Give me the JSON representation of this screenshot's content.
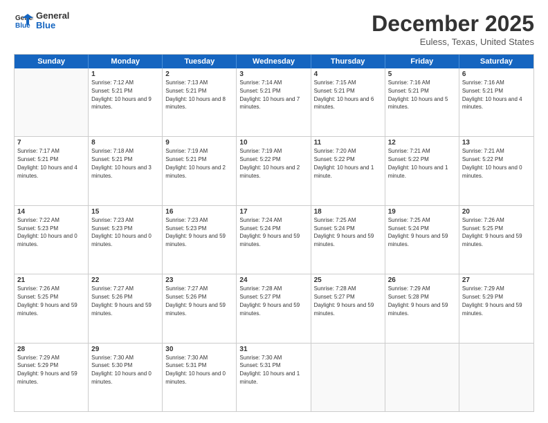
{
  "logo": {
    "line1": "General",
    "line2": "Blue"
  },
  "title": "December 2025",
  "subtitle": "Euless, Texas, United States",
  "days_header": [
    "Sunday",
    "Monday",
    "Tuesday",
    "Wednesday",
    "Thursday",
    "Friday",
    "Saturday"
  ],
  "weeks": [
    [
      {
        "day": "",
        "empty": true
      },
      {
        "day": "1",
        "sunrise": "7:12 AM",
        "sunset": "5:21 PM",
        "daylight": "10 hours and 9 minutes."
      },
      {
        "day": "2",
        "sunrise": "7:13 AM",
        "sunset": "5:21 PM",
        "daylight": "10 hours and 8 minutes."
      },
      {
        "day": "3",
        "sunrise": "7:14 AM",
        "sunset": "5:21 PM",
        "daylight": "10 hours and 7 minutes."
      },
      {
        "day": "4",
        "sunrise": "7:15 AM",
        "sunset": "5:21 PM",
        "daylight": "10 hours and 6 minutes."
      },
      {
        "day": "5",
        "sunrise": "7:16 AM",
        "sunset": "5:21 PM",
        "daylight": "10 hours and 5 minutes."
      },
      {
        "day": "6",
        "sunrise": "7:16 AM",
        "sunset": "5:21 PM",
        "daylight": "10 hours and 4 minutes."
      }
    ],
    [
      {
        "day": "7",
        "sunrise": "7:17 AM",
        "sunset": "5:21 PM",
        "daylight": "10 hours and 4 minutes."
      },
      {
        "day": "8",
        "sunrise": "7:18 AM",
        "sunset": "5:21 PM",
        "daylight": "10 hours and 3 minutes."
      },
      {
        "day": "9",
        "sunrise": "7:19 AM",
        "sunset": "5:21 PM",
        "daylight": "10 hours and 2 minutes."
      },
      {
        "day": "10",
        "sunrise": "7:19 AM",
        "sunset": "5:22 PM",
        "daylight": "10 hours and 2 minutes."
      },
      {
        "day": "11",
        "sunrise": "7:20 AM",
        "sunset": "5:22 PM",
        "daylight": "10 hours and 1 minute."
      },
      {
        "day": "12",
        "sunrise": "7:21 AM",
        "sunset": "5:22 PM",
        "daylight": "10 hours and 1 minute."
      },
      {
        "day": "13",
        "sunrise": "7:21 AM",
        "sunset": "5:22 PM",
        "daylight": "10 hours and 0 minutes."
      }
    ],
    [
      {
        "day": "14",
        "sunrise": "7:22 AM",
        "sunset": "5:23 PM",
        "daylight": "10 hours and 0 minutes."
      },
      {
        "day": "15",
        "sunrise": "7:23 AM",
        "sunset": "5:23 PM",
        "daylight": "10 hours and 0 minutes."
      },
      {
        "day": "16",
        "sunrise": "7:23 AM",
        "sunset": "5:23 PM",
        "daylight": "9 hours and 59 minutes."
      },
      {
        "day": "17",
        "sunrise": "7:24 AM",
        "sunset": "5:24 PM",
        "daylight": "9 hours and 59 minutes."
      },
      {
        "day": "18",
        "sunrise": "7:25 AM",
        "sunset": "5:24 PM",
        "daylight": "9 hours and 59 minutes."
      },
      {
        "day": "19",
        "sunrise": "7:25 AM",
        "sunset": "5:24 PM",
        "daylight": "9 hours and 59 minutes."
      },
      {
        "day": "20",
        "sunrise": "7:26 AM",
        "sunset": "5:25 PM",
        "daylight": "9 hours and 59 minutes."
      }
    ],
    [
      {
        "day": "21",
        "sunrise": "7:26 AM",
        "sunset": "5:25 PM",
        "daylight": "9 hours and 59 minutes."
      },
      {
        "day": "22",
        "sunrise": "7:27 AM",
        "sunset": "5:26 PM",
        "daylight": "9 hours and 59 minutes."
      },
      {
        "day": "23",
        "sunrise": "7:27 AM",
        "sunset": "5:26 PM",
        "daylight": "9 hours and 59 minutes."
      },
      {
        "day": "24",
        "sunrise": "7:28 AM",
        "sunset": "5:27 PM",
        "daylight": "9 hours and 59 minutes."
      },
      {
        "day": "25",
        "sunrise": "7:28 AM",
        "sunset": "5:27 PM",
        "daylight": "9 hours and 59 minutes."
      },
      {
        "day": "26",
        "sunrise": "7:29 AM",
        "sunset": "5:28 PM",
        "daylight": "9 hours and 59 minutes."
      },
      {
        "day": "27",
        "sunrise": "7:29 AM",
        "sunset": "5:29 PM",
        "daylight": "9 hours and 59 minutes."
      }
    ],
    [
      {
        "day": "28",
        "sunrise": "7:29 AM",
        "sunset": "5:29 PM",
        "daylight": "9 hours and 59 minutes."
      },
      {
        "day": "29",
        "sunrise": "7:30 AM",
        "sunset": "5:30 PM",
        "daylight": "10 hours and 0 minutes."
      },
      {
        "day": "30",
        "sunrise": "7:30 AM",
        "sunset": "5:31 PM",
        "daylight": "10 hours and 0 minutes."
      },
      {
        "day": "31",
        "sunrise": "7:30 AM",
        "sunset": "5:31 PM",
        "daylight": "10 hours and 1 minute."
      },
      {
        "day": "",
        "empty": true
      },
      {
        "day": "",
        "empty": true
      },
      {
        "day": "",
        "empty": true
      }
    ]
  ],
  "labels": {
    "sunrise": "Sunrise:",
    "sunset": "Sunset:",
    "daylight": "Daylight:"
  }
}
